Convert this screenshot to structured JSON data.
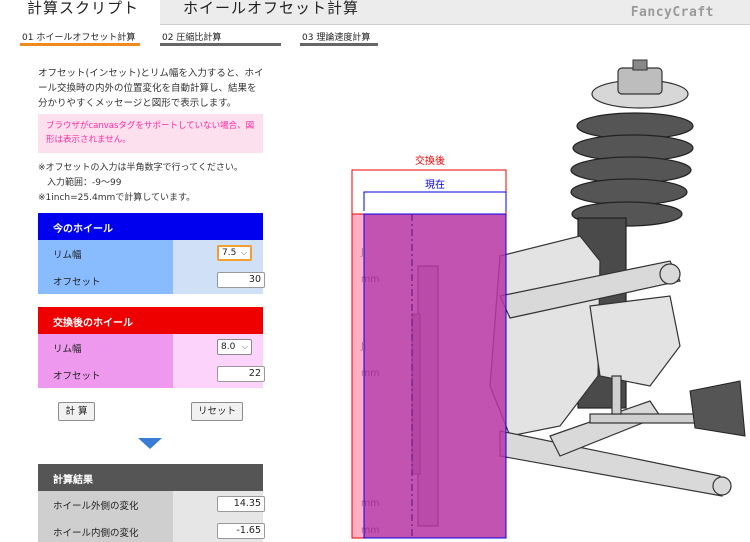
{
  "header": {
    "app_title": "計算スクリプト",
    "page_title": "ホイールオフセット計算",
    "brand": "FancyCraft"
  },
  "nav": {
    "tabs": [
      {
        "label": "01 ホイールオフセット計算",
        "active": true
      },
      {
        "label": "02 圧縮比計算",
        "active": false
      },
      {
        "label": "03 理論速度計算",
        "active": false
      }
    ]
  },
  "intro": {
    "lines": [
      "オフセット(インセット)とリム幅を入力すると、ホイ",
      "ール交換時の内外の位置変化を自動計算し、結果を",
      "分かりやすくメッセージと図形で表示します。"
    ]
  },
  "warning": {
    "lines": [
      "ブラウザがcanvasタグをサポートしていない場合、図",
      "形は表示されません。"
    ]
  },
  "notes": {
    "lines": [
      "※オフセットの入力は半角数字で行ってください。",
      "　入力範囲：-9〜99",
      "※1inch=25.4mmで計算しています。"
    ]
  },
  "current_wheel": {
    "title": "今のホイール",
    "rim_label": "リム幅",
    "rim_value": "7.5",
    "rim_unit": "J",
    "offset_label": "オフセット",
    "offset_value": "30",
    "offset_unit": "mm"
  },
  "new_wheel": {
    "title": "交換後のホイール",
    "rim_label": "リム幅",
    "rim_value": "8.0",
    "rim_unit": "J",
    "offset_label": "オフセット",
    "offset_value": "22",
    "offset_unit": "mm"
  },
  "buttons": {
    "calculate": "計 算",
    "reset": "リセット"
  },
  "result": {
    "title": "計算結果",
    "outer_label": "ホイール外側の変化",
    "outer_value": "14.35",
    "outer_unit": "mm",
    "inner_label": "ホイール内側の変化",
    "inner_value": "-1.65",
    "inner_unit": "mm"
  },
  "diagram": {
    "after_label": "交換後",
    "current_label": "現在"
  },
  "colors": {
    "accent_orange": "#f08a1c",
    "current_blue": "#0000ee",
    "new_red": "#ee0000",
    "result_gray": "#555555"
  }
}
